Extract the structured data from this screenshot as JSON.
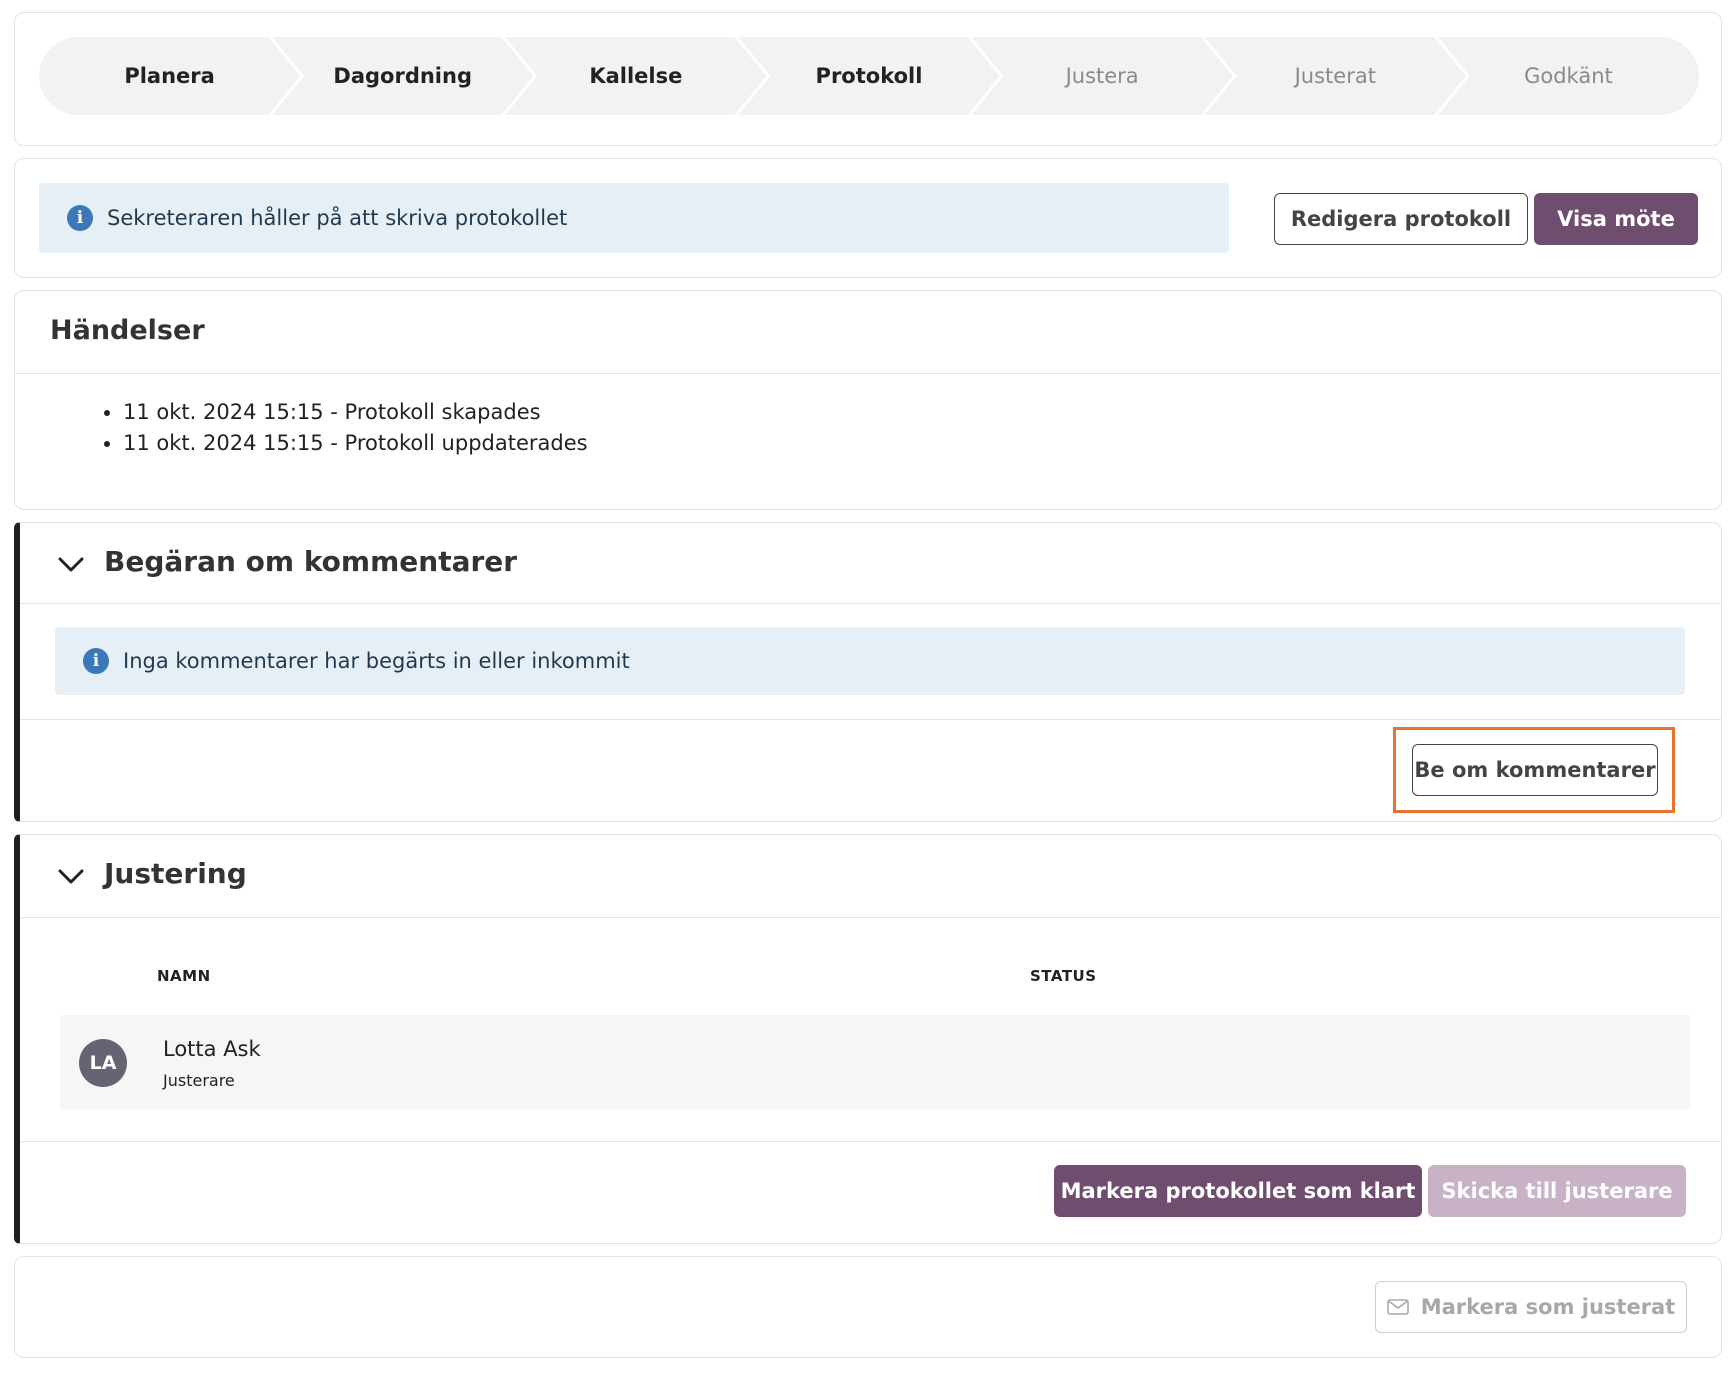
{
  "stepper": {
    "steps": [
      {
        "label": "Planera",
        "state": "done"
      },
      {
        "label": "Dagordning",
        "state": "done"
      },
      {
        "label": "Kallelse",
        "state": "done"
      },
      {
        "label": "Protokoll",
        "state": "current"
      },
      {
        "label": "Justera",
        "state": "upcoming"
      },
      {
        "label": "Justerat",
        "state": "upcoming"
      },
      {
        "label": "Godkänt",
        "state": "upcoming"
      }
    ]
  },
  "status": {
    "message": "Sekreteraren håller på att skriva protokollet",
    "edit_button": "Redigera protokoll",
    "view_button": "Visa möte"
  },
  "events": {
    "title": "Händelser",
    "items": [
      "11 okt. 2024 15:15 - Protokoll skapades",
      "11 okt. 2024 15:15 - Protokoll uppdaterades"
    ]
  },
  "comments": {
    "title": "Begäran om kommentarer",
    "info": "Inga kommentarer har begärts in eller inkommit",
    "request_button": "Be om kommentarer"
  },
  "justering": {
    "title": "Justering",
    "columns": {
      "name": "NAMN",
      "status": "STATUS"
    },
    "people": [
      {
        "initials": "LA",
        "name": "Lotta Ask",
        "role": "Justerare",
        "status": ""
      }
    ],
    "mark_ready_button": "Markera protokollet som klart",
    "send_button": "Skicka till justerare"
  },
  "footer": {
    "mark_adjusted_button": "Markera som justerat"
  },
  "colors": {
    "primary": "#6e4d6e",
    "primary_disabled": "#c7b2c6",
    "info_bg": "#e7eff6",
    "info_icon": "#3b78b8",
    "highlight": "#e87330"
  }
}
